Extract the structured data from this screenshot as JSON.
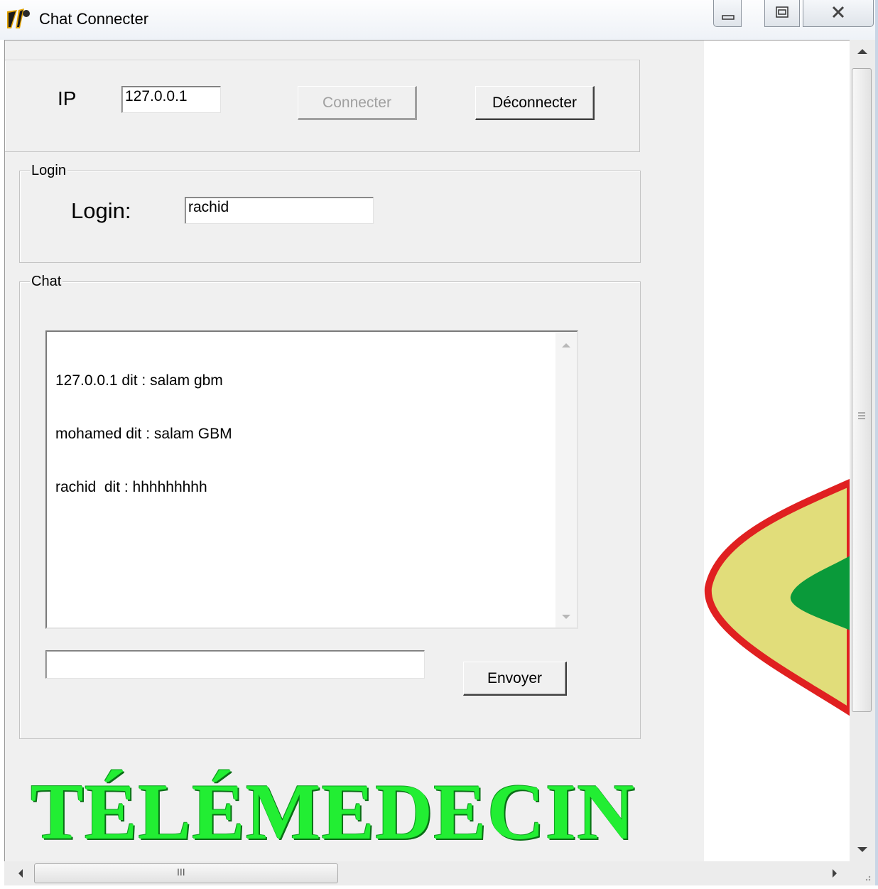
{
  "window": {
    "title": "Chat Connecter",
    "icon": "delphi-helmet-icon",
    "controls": [
      "minimize-icon",
      "maximize-icon",
      "close-icon"
    ]
  },
  "connection": {
    "ip_label": "IP",
    "ip_value": "127.0.0.1",
    "connect_label": "Connecter",
    "disconnect_label": "Déconnecter"
  },
  "login": {
    "group_title": "Login",
    "label": "Login:",
    "value": "rachid"
  },
  "chat": {
    "group_title": "Chat",
    "messages": [
      "127.0.0.1 dit : salam gbm",
      "mohamed dit : salam GBM",
      "rachid  dit : hhhhhhhhh"
    ],
    "input_value": "",
    "send_label": "Envoyer"
  },
  "brand": {
    "text": "TÉLÉMEDECIN",
    "color": "#22ee33"
  },
  "scrollbars": {
    "horizontal_grip": "III"
  }
}
